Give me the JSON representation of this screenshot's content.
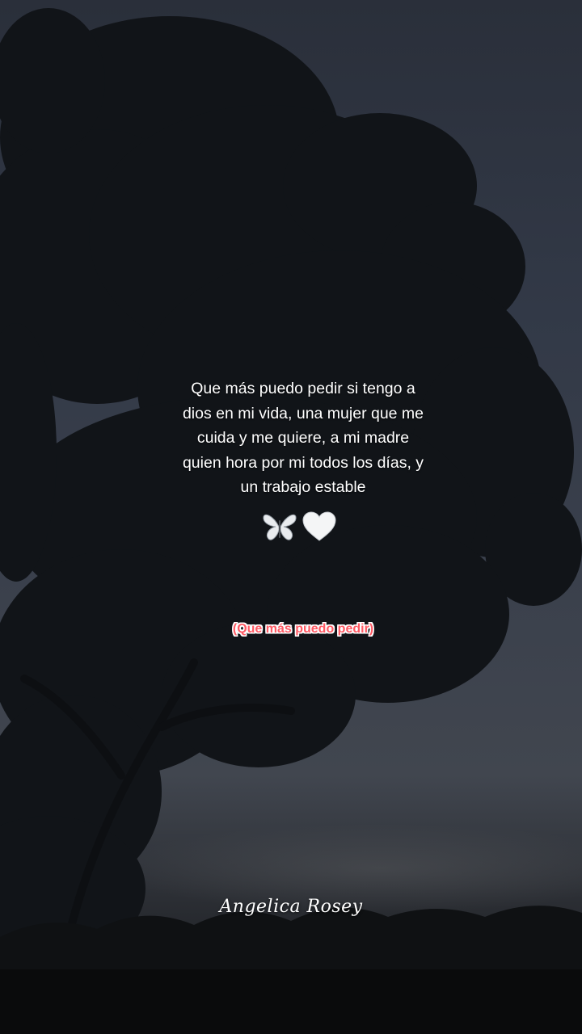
{
  "quote": {
    "lines": [
      "Que más puedo pedir si tengo a",
      "dios en mi vida, una mujer que me",
      "cuida y me quiere, a mi madre",
      "quien hora por mi todos los días, y",
      "un trabajo estable"
    ]
  },
  "decorations": {
    "icons": [
      "butterfly-icon",
      "white-heart-icon"
    ]
  },
  "caption": {
    "text": "(Que más puedo pedir)",
    "color": "#ff5a64"
  },
  "signature": {
    "text": "Angelica Rosey"
  },
  "colors": {
    "sky_top": "#2a2f3a",
    "sky_horizon": "#41464f",
    "foliage": "#101317"
  }
}
